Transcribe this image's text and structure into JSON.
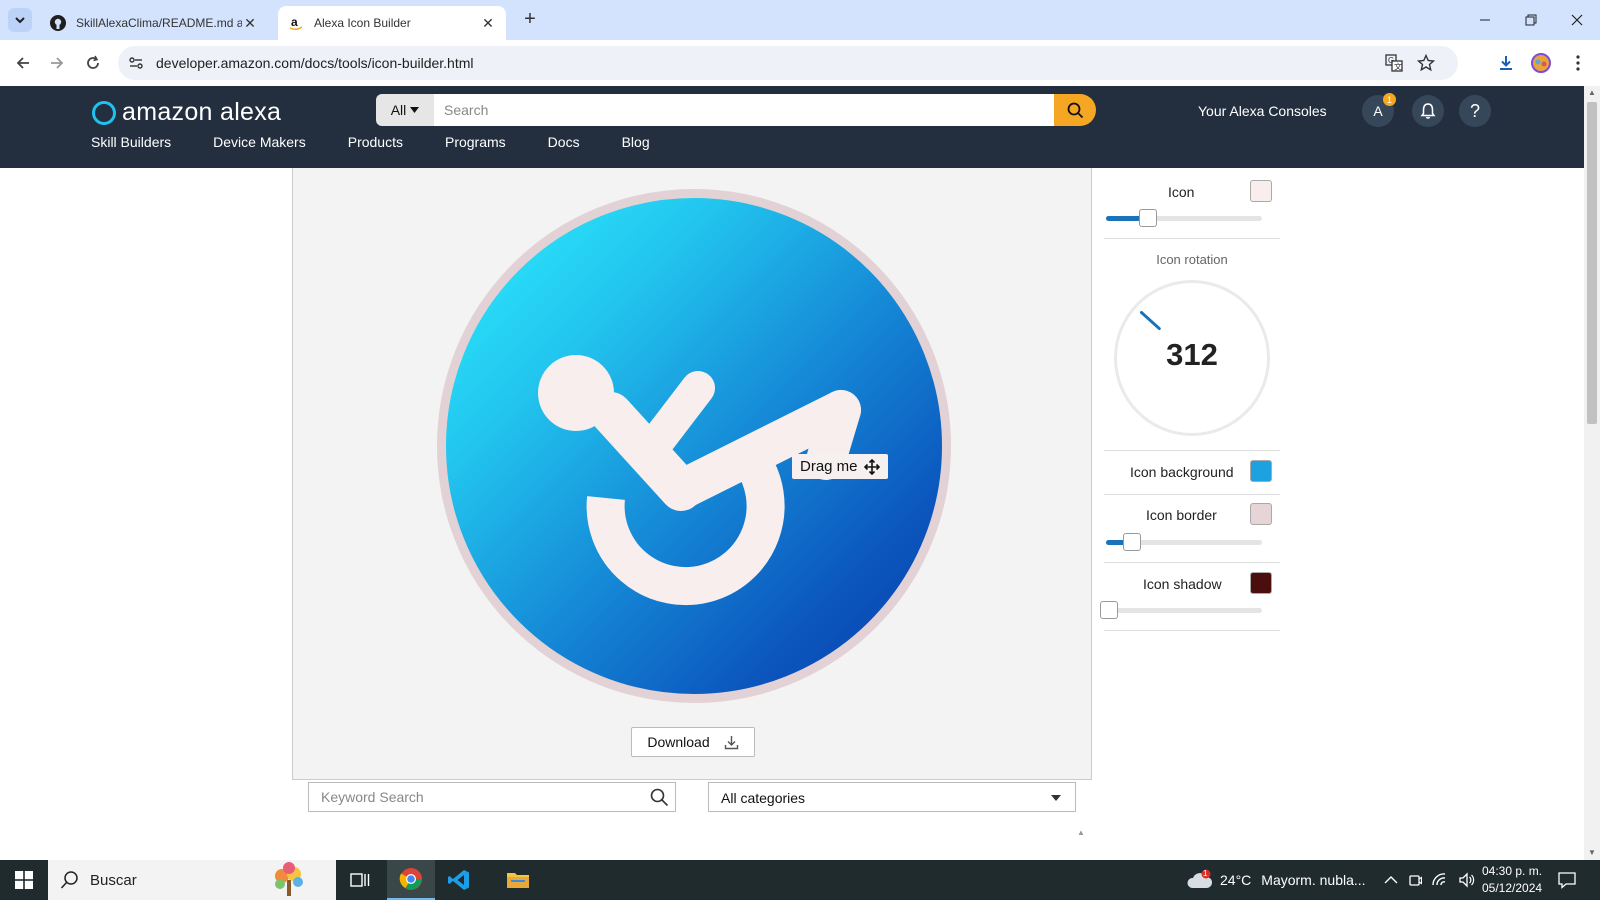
{
  "browser": {
    "tabs": [
      {
        "title": "SkillAlexaClima/README.md at",
        "favicon": "github-icon",
        "active": false
      },
      {
        "title": "Alexa Icon Builder",
        "favicon": "amazon-icon",
        "active": true
      }
    ],
    "url": "developer.amazon.com/docs/tools/icon-builder.html"
  },
  "header": {
    "logo": "amazon alexa",
    "search_category": "All",
    "search_placeholder": "Search",
    "consoles_label": "Your Alexa Consoles",
    "avatar_initial": "A",
    "notification_count": "1",
    "help_label": "?",
    "nav": [
      "Skill Builders",
      "Device Makers",
      "Products",
      "Programs",
      "Docs",
      "Blog"
    ]
  },
  "builder": {
    "drag_label": "Drag me",
    "download_label": "Download",
    "icon": {
      "label": "Icon",
      "color": "#f8eeee",
      "size_fraction": 0.24
    },
    "rotation": {
      "label": "Icon rotation",
      "value": "312",
      "degrees": 312
    },
    "background": {
      "label": "Icon background",
      "color": "#1ea1e0"
    },
    "border": {
      "label": "Icon border",
      "color": "#e6d4d7",
      "width_fraction": 0.12
    },
    "shadow": {
      "label": "Icon shadow",
      "color": "#4a0e0e",
      "amount_fraction": 0.0
    },
    "keyword_placeholder": "Keyword Search",
    "category_selected": "All categories"
  },
  "taskbar": {
    "search_text": "Buscar",
    "weather_temp": "24°C",
    "weather_text": "Mayorm. nubla...",
    "weather_badge": "1",
    "time": "04:30 p. m.",
    "date": "05/12/2024"
  }
}
